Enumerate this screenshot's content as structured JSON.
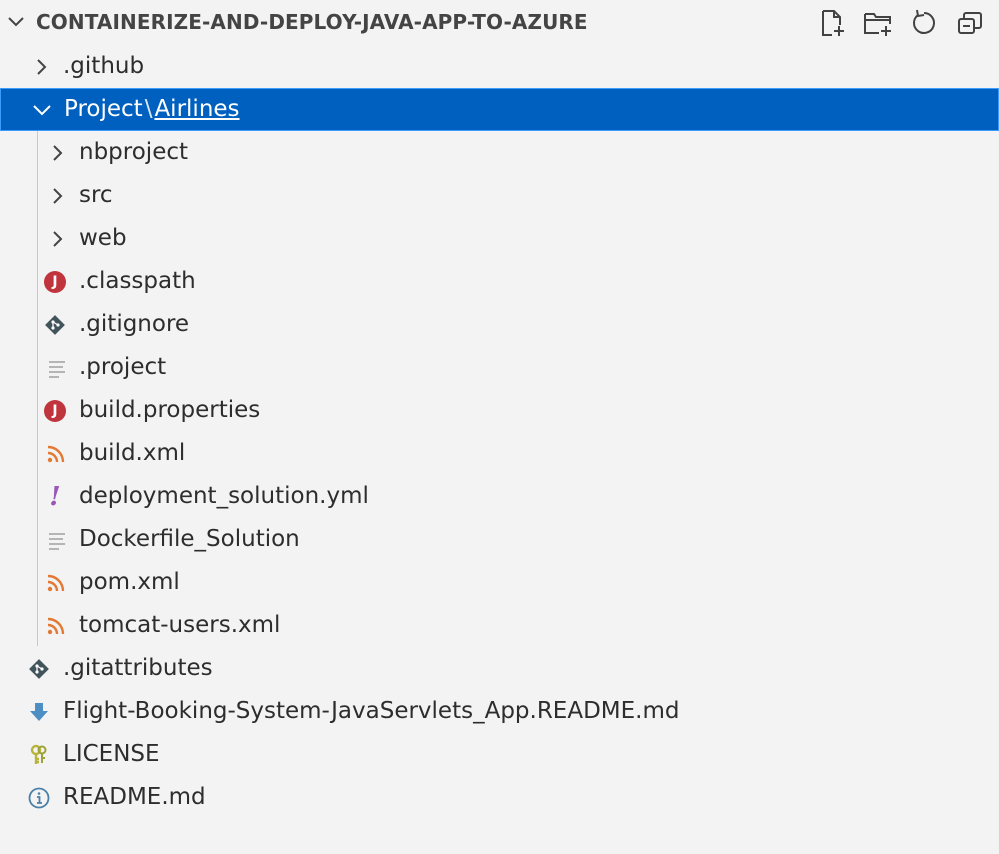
{
  "explorer": {
    "title": "CONTAINERIZE-AND-DEPLOY-JAVA-APP-TO-AZURE",
    "actions": [
      {
        "name": "new-file",
        "icon": "new-file-icon"
      },
      {
        "name": "new-folder",
        "icon": "new-folder-icon"
      },
      {
        "name": "refresh",
        "icon": "refresh-icon"
      },
      {
        "name": "collapse-all",
        "icon": "collapse-all-icon"
      }
    ]
  },
  "tree": {
    "github": ".github",
    "project": {
      "part1": "Project",
      "separator": "\\",
      "part2": "Airlines"
    },
    "nbproject": "nbproject",
    "src": "src",
    "web": "web",
    "classpath": ".classpath",
    "gitignore": ".gitignore",
    "project_file": ".project",
    "build_properties": "build.properties",
    "build_xml": "build.xml",
    "deployment_yml": "deployment_solution.yml",
    "dockerfile": "Dockerfile_Solution",
    "pom_xml": "pom.xml",
    "tomcat_users": "tomcat-users.xml",
    "gitattributes": ".gitattributes",
    "readme_flight": "Flight-Booking-System-JavaServlets_App.README.md",
    "license": "LICENSE",
    "readme": "README.md"
  },
  "colors": {
    "background": "#f3f3f3",
    "selection": "#0060c0",
    "java_badge": "#c0353d",
    "xml_rss": "#e37933",
    "yaml": "#9a57b8",
    "git": "#41535b",
    "markdown_arrow": "#4d8fc4",
    "license_key": "#b8b33a",
    "info": "#4a7fa8"
  }
}
